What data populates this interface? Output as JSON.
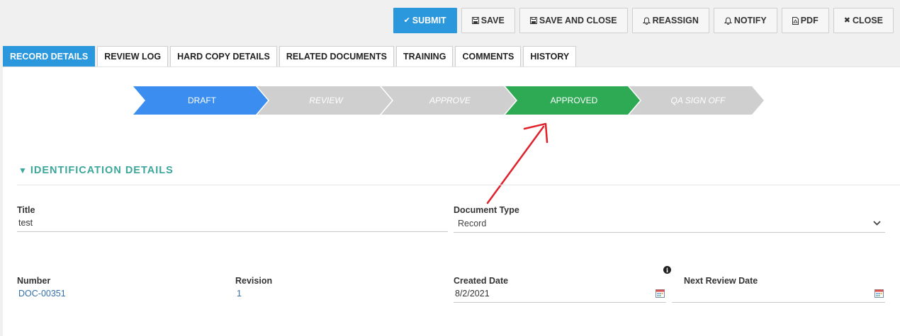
{
  "toolbar": {
    "submit": "SUBMIT",
    "save": "SAVE",
    "save_and_close": "SAVE AND CLOSE",
    "reassign": "REASSIGN",
    "notify": "NOTIFY",
    "pdf": "PDF",
    "close": "CLOSE"
  },
  "tabs": [
    {
      "label": "RECORD DETAILS",
      "active": true
    },
    {
      "label": "REVIEW LOG"
    },
    {
      "label": "HARD COPY DETAILS"
    },
    {
      "label": "RELATED DOCUMENTS"
    },
    {
      "label": "TRAINING"
    },
    {
      "label": "COMMENTS"
    },
    {
      "label": "HISTORY"
    }
  ],
  "workflow": {
    "steps": [
      {
        "label": "DRAFT",
        "state": "current"
      },
      {
        "label": "REVIEW",
        "state": "pending"
      },
      {
        "label": "APPROVE",
        "state": "pending"
      },
      {
        "label": "APPROVED",
        "state": "done"
      },
      {
        "label": "QA SIGN OFF",
        "state": "pending"
      }
    ]
  },
  "section": {
    "title": "IDENTIFICATION DETAILS"
  },
  "fields": {
    "title": {
      "label": "Title",
      "value": "test"
    },
    "document_type": {
      "label": "Document Type",
      "value": "Record"
    },
    "number": {
      "label": "Number",
      "value": "DOC-00351"
    },
    "revision": {
      "label": "Revision",
      "value": "1"
    },
    "created_date": {
      "label": "Created Date",
      "value": "8/2/2021"
    },
    "next_review_date": {
      "label": "Next Review Date",
      "value": ""
    }
  },
  "colors": {
    "primary": "#2b97dc",
    "workflow_current": "#3b8ef0",
    "workflow_done": "#2eaa55",
    "workflow_pending": "#cfcfcf",
    "section_accent": "#3aa79a",
    "annotation_arrow": "#e0202a"
  }
}
